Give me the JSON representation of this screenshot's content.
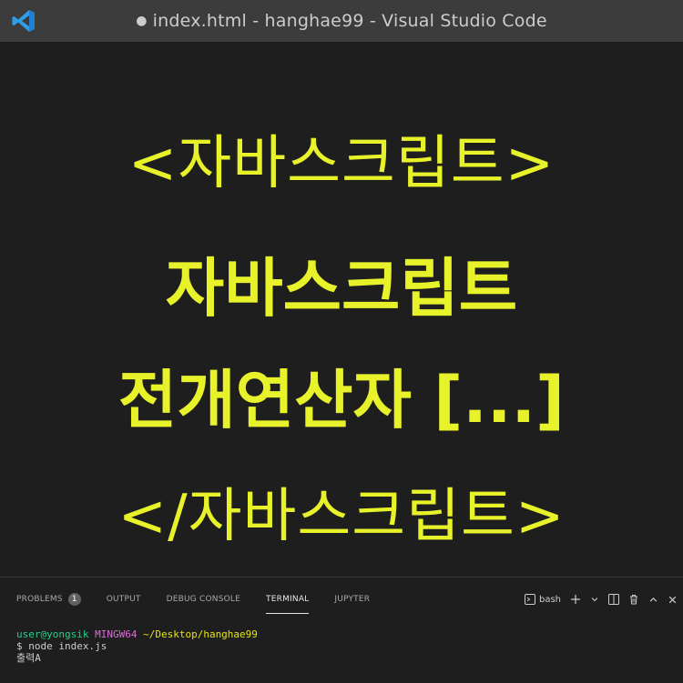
{
  "window": {
    "dirty_marker": "●",
    "title": "index.html - hanghae99 - Visual Studio Code",
    "accent_color": "#3c3c3c"
  },
  "editor": {
    "lines": [
      "<자바스크립트>",
      "자바스크립트",
      "전개연산자 [...]",
      "</자바스크립트>"
    ],
    "text_color": "#e8f22a"
  },
  "panel": {
    "tabs": [
      {
        "label": "PROBLEMS",
        "badge": "1"
      },
      {
        "label": "OUTPUT"
      },
      {
        "label": "DEBUG CONSOLE"
      },
      {
        "label": "TERMINAL",
        "active": true
      },
      {
        "label": "JUPYTER"
      }
    ],
    "actions": {
      "shell": "bash",
      "icons": [
        "terminal-icon",
        "plus-icon",
        "chevron-down-icon",
        "split-icon",
        "trash-icon",
        "chevron-up-icon",
        "close-icon"
      ]
    }
  },
  "terminal": {
    "prompt_user": "user@yongsik",
    "prompt_host": "MINGW64",
    "prompt_path": "~/Desktop/hanghae99",
    "command": "$ node index.js",
    "output": "출력A"
  }
}
